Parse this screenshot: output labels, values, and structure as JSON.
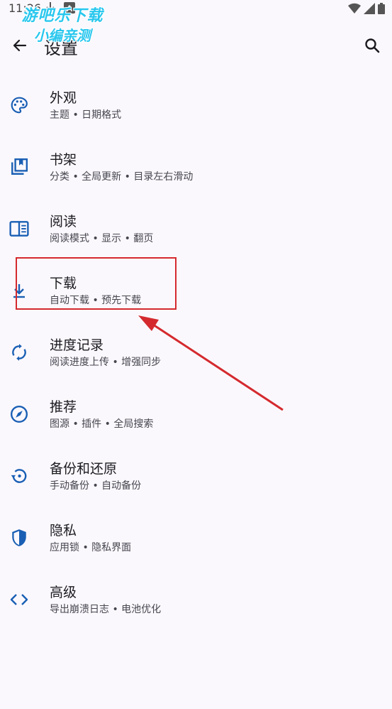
{
  "status_bar": {
    "time": "11:26",
    "a_glyph": "A"
  },
  "watermark": {
    "line1": "游吧乐下载",
    "line2": "小编亲测"
  },
  "header": {
    "title": "设置"
  },
  "items": [
    {
      "title": "外观",
      "subtitle": "主题 • 日期格式",
      "icon": "palette-icon"
    },
    {
      "title": "书架",
      "subtitle": "分类 • 全局更新 • 目录左右滑动",
      "icon": "library-icon"
    },
    {
      "title": "阅读",
      "subtitle": "阅读模式 • 显示 • 翻页",
      "icon": "reader-icon"
    },
    {
      "title": "下载",
      "subtitle": "自动下载 • 预先下载",
      "icon": "download-icon"
    },
    {
      "title": "进度记录",
      "subtitle": "阅读进度上传 • 增强同步",
      "icon": "sync-icon"
    },
    {
      "title": "推荐",
      "subtitle": "图源 • 插件 • 全局搜索",
      "icon": "compass-icon"
    },
    {
      "title": "备份和还原",
      "subtitle": "手动备份 • 自动备份",
      "icon": "backup-restore-icon"
    },
    {
      "title": "隐私",
      "subtitle": "应用锁 • 隐私界面",
      "icon": "shield-icon"
    },
    {
      "title": "高级",
      "subtitle": "导出崩溃日志 • 电池优化",
      "icon": "code-icon"
    }
  ],
  "colors": {
    "accent": "#1a5fb4",
    "annotation": "#d42a2e",
    "background": "#fbf8fd"
  }
}
